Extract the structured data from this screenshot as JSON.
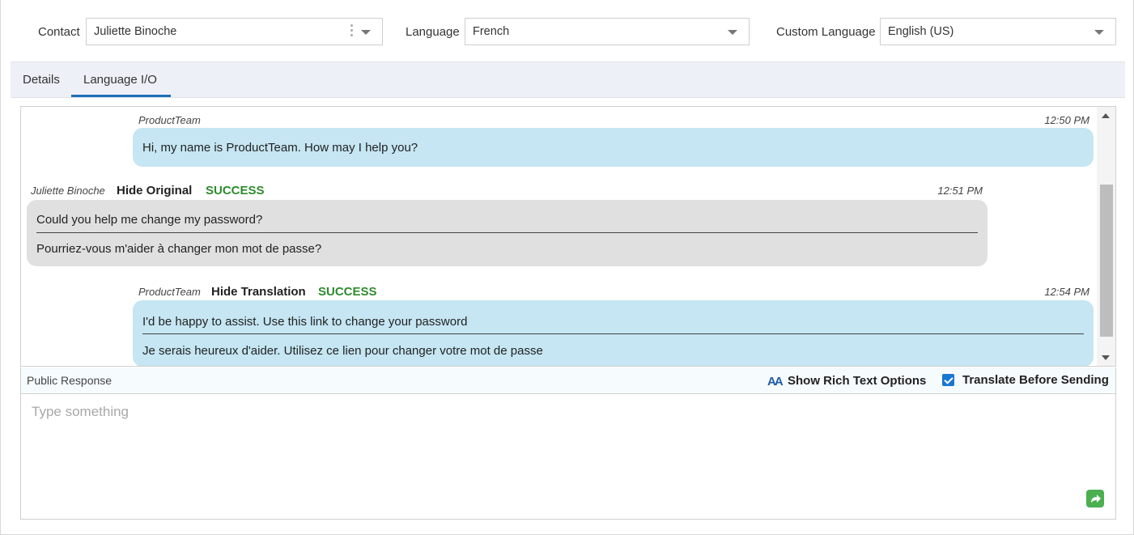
{
  "header": {
    "contact_label": "Contact",
    "contact_value": "Juliette Binoche",
    "language_label": "Language",
    "language_value": "French",
    "custom_language_label": "Custom Language",
    "custom_language_value": "English (US)"
  },
  "tabs": [
    {
      "label": "Details",
      "active": false
    },
    {
      "label": "Language I/O",
      "active": true
    }
  ],
  "messages": [
    {
      "sender": "ProductTeam",
      "role": "agent",
      "time": "12:50 PM",
      "lines": [
        "Hi, my name is ProductTeam. How may I help you?"
      ]
    },
    {
      "sender": "Juliette Binoche",
      "role": "customer",
      "action": "Hide Original",
      "status": "SUCCESS",
      "time": "12:51 PM",
      "lines": [
        "Could you help me change my password?",
        "Pourriez-vous m'aider à changer mon mot de passe?"
      ]
    },
    {
      "sender": "ProductTeam",
      "role": "agent",
      "action": "Hide Translation",
      "status": "SUCCESS",
      "time": "12:54 PM",
      "lines": [
        "I'd be happy to assist. Use this link to change your password",
        "Je serais heureux d'aider. Utilisez ce lien pour changer votre mot de passe"
      ]
    }
  ],
  "response": {
    "title": "Public Response",
    "rich_text_icon": "AA",
    "rich_text_label": "Show Rich Text Options",
    "translate_label": "Translate Before Sending",
    "translate_checked": true,
    "placeholder": "Type something"
  },
  "colors": {
    "agent_bubble": "#c5e6f2",
    "customer_bubble": "#e0e0e0",
    "success": "#2e8b2e",
    "tab_active": "#1f6fb8",
    "send_button": "#4caf50"
  }
}
